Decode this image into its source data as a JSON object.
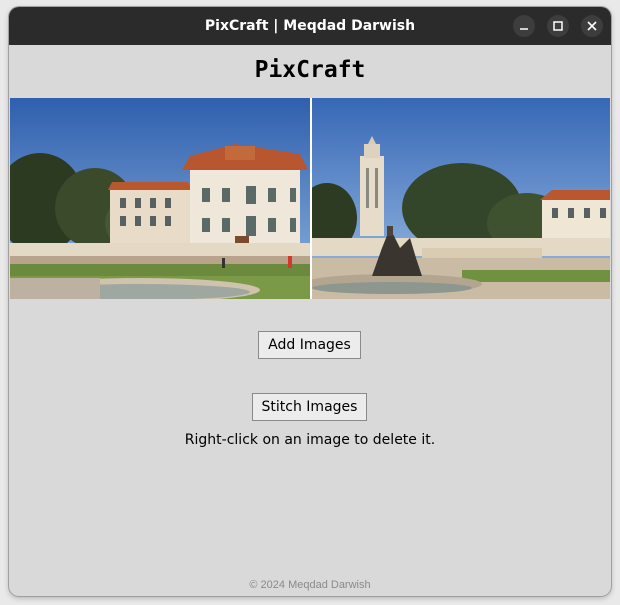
{
  "window": {
    "title": "PixCraft | Meqdad Darwish",
    "controls": [
      "minimize-icon",
      "maximize-icon",
      "close-icon"
    ]
  },
  "app": {
    "heading": "PixCraft"
  },
  "images": [
    {
      "name": "campus-building-photo"
    },
    {
      "name": "campus-tower-fountain-photo"
    }
  ],
  "buttons": {
    "add_images": "Add Images",
    "stitch_images": "Stitch Images"
  },
  "hint": "Right-click on an image to delete it.",
  "footer": "© 2024 Meqdad Darwish",
  "colors": {
    "titlebar": "#2b2b2b",
    "window_bg": "#d9d9d9",
    "button_bg": "#ececec"
  }
}
